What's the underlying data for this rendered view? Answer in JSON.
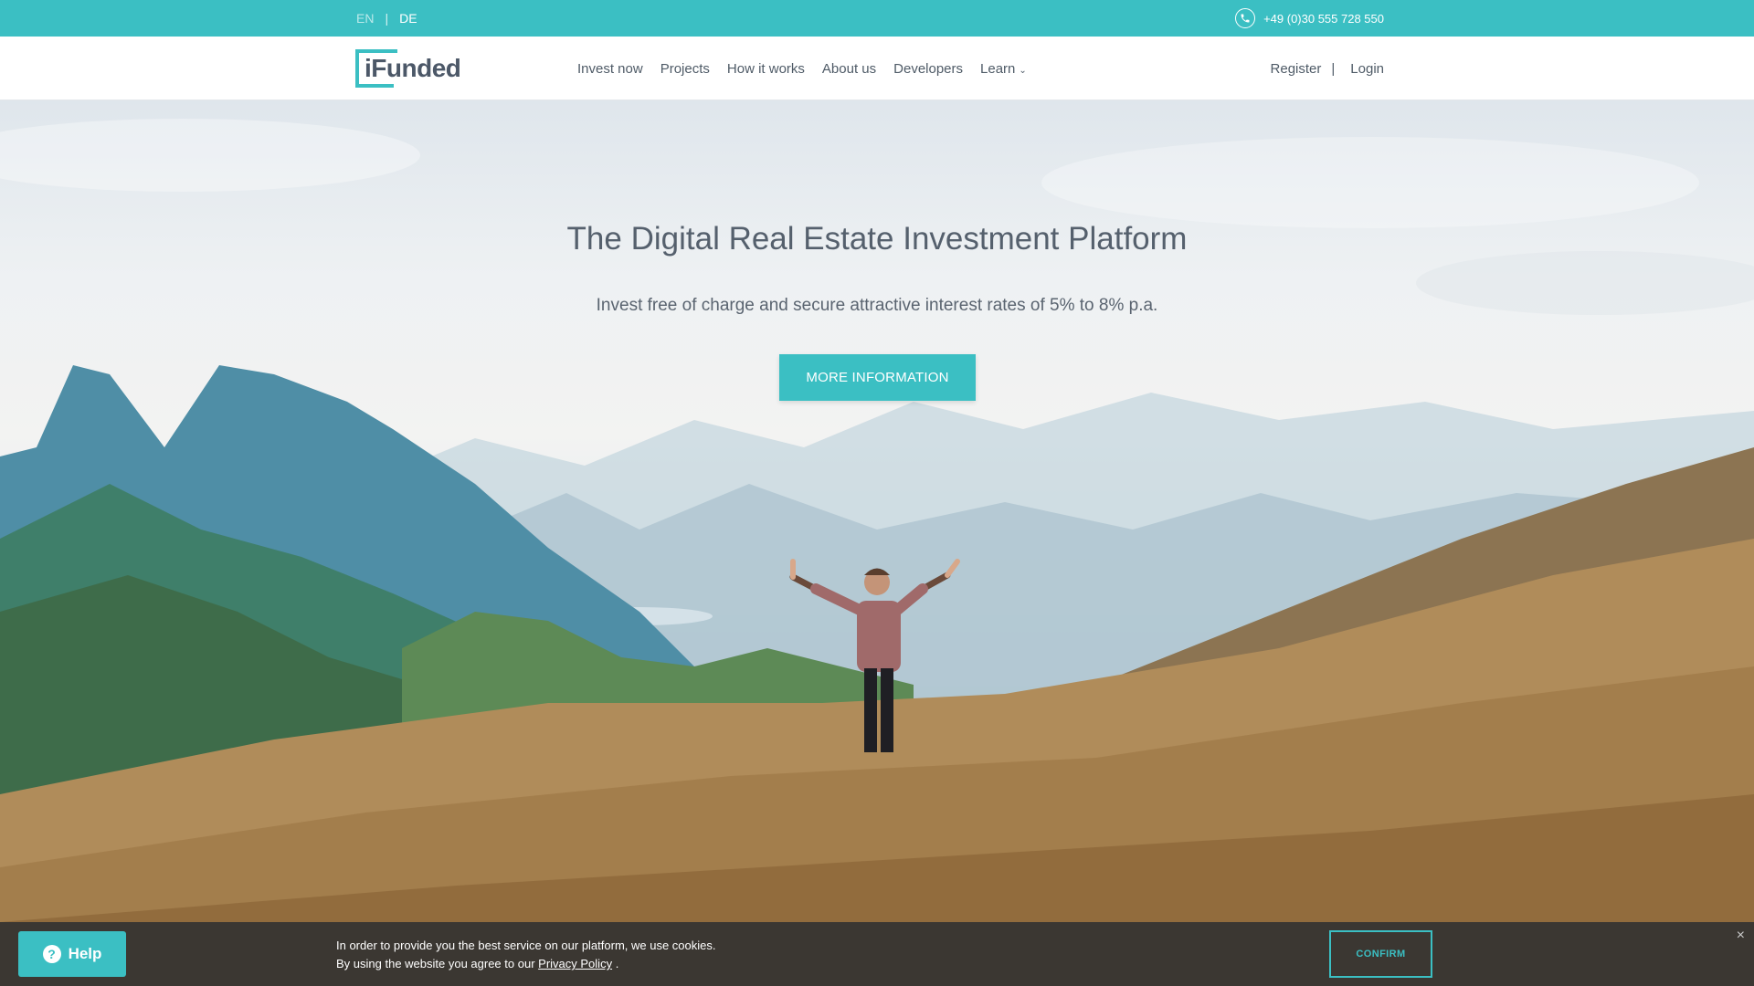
{
  "topbar": {
    "lang_en": "EN",
    "lang_separator": "|",
    "lang_de": "DE",
    "phone": "+49 (0)30 555 728 550"
  },
  "brand": {
    "logo_text": "iFunded"
  },
  "nav": {
    "items": [
      {
        "label": "Invest now"
      },
      {
        "label": "Projects"
      },
      {
        "label": "How it works"
      },
      {
        "label": "About us"
      },
      {
        "label": "Developers"
      },
      {
        "label": "Learn"
      }
    ],
    "register": "Register",
    "separator": "|",
    "login": "Login"
  },
  "hero": {
    "title": "The Digital Real Estate Investment Platform",
    "subtitle": "Invest free of charge and secure attractive interest rates of 5% to 8% p.a.",
    "cta_label": "MORE INFORMATION"
  },
  "cookie": {
    "line1": "In order to provide you the best service on our platform, we use cookies.",
    "line2_prefix": "By using the website you agree to our",
    "policy_link": "Privacy Policy",
    "line2_suffix": ".",
    "confirm_label": "CONFIRM",
    "close_symbol": "×"
  },
  "help": {
    "label": "Help"
  },
  "colors": {
    "accent": "#3bbfc3",
    "text": "#4f5b67"
  },
  "icons": [
    "phone-icon",
    "chevron-down-icon",
    "question-icon",
    "close-icon"
  ]
}
